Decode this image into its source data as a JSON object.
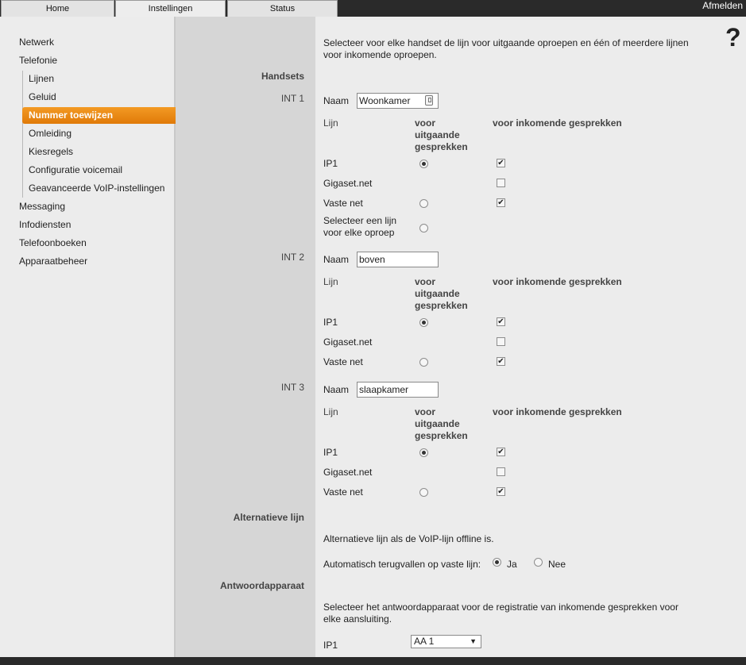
{
  "tabs": {
    "home": "Home",
    "settings": "Instellingen",
    "status": "Status"
  },
  "logout": "Afmelden",
  "nav": {
    "network": "Netwerk",
    "telephony": "Telefonie",
    "lines": "Lijnen",
    "sound": "Geluid",
    "number_assign": "Nummer toewijzen",
    "forwarding": "Omleiding",
    "dial_rules": "Kiesregels",
    "voicemail_config": "Configuratie voicemail",
    "advanced_voip": "Geavanceerde VoIP-instellingen",
    "messaging": "Messaging",
    "info_services": "Infodiensten",
    "phonebooks": "Telefoonboeken",
    "device_management": "Apparaatbeheer"
  },
  "help_symbol": "?",
  "intro_line1": "Selecteer voor elke handset de lijn voor uitgaande oproepen en één of meerdere lijnen",
  "intro_line2": "voor inkomende oproepen.",
  "section_handsets": "Handsets",
  "name_label": "Naam",
  "col_line": "Lijn",
  "col_out_1": "voor",
  "col_out_2": "uitgaande",
  "col_out_3": "gesprekken",
  "col_in": "voor inkomende gesprekken",
  "line_ip1": "IP1",
  "line_gigaset": "Gigaset.net",
  "line_fixed": "Vaste net",
  "select_line_1": "Selecteer een lijn",
  "select_line_2": "voor elke oproep",
  "handsets": [
    {
      "int_label": "INT 1",
      "name": "Woonkamer",
      "outgoing": {
        "ip1": true,
        "fixed": false,
        "select_each": false
      },
      "incoming": {
        "ip1": true,
        "gigaset": false,
        "fixed": true
      }
    },
    {
      "int_label": "INT 2",
      "name": "boven",
      "outgoing": {
        "ip1": true,
        "fixed": false
      },
      "incoming": {
        "ip1": true,
        "gigaset": false,
        "fixed": true
      }
    },
    {
      "int_label": "INT 3",
      "name": "slaapkamer",
      "outgoing": {
        "ip1": true,
        "fixed": false
      },
      "incoming": {
        "ip1": true,
        "gigaset": false,
        "fixed": true
      }
    }
  ],
  "section_alt": "Alternatieve lijn",
  "alt_desc": "Alternatieve lijn als de VoIP-lijn offline is.",
  "alt_fallback_label": "Automatisch terugvallen op vaste lijn:",
  "alt_yes": "Ja",
  "alt_no": "Nee",
  "alt_selected": "Ja",
  "section_am": "Antwoordapparaat",
  "am_desc_1": "Selecteer het antwoordapparaat voor de registratie van inkomende gesprekken voor",
  "am_desc_2": "elke aansluiting.",
  "am_line": "IP1",
  "am_value": "AA 1",
  "colors": {
    "accent": "#e8860f",
    "topbar": "#2a2a2a"
  }
}
